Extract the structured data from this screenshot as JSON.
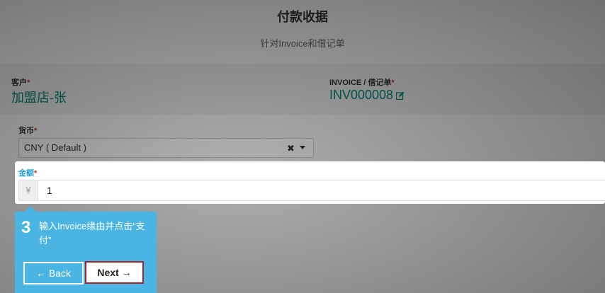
{
  "header": {
    "title": "付款收据",
    "subtitle": "针对Invoice和借记单"
  },
  "customer": {
    "label": "客户",
    "required_mark": "*",
    "value": "加盟店-张"
  },
  "invoice": {
    "label": "INVOICE / 借记单",
    "required_mark": "*",
    "value": "INV000008"
  },
  "currency": {
    "label": "货币",
    "required_mark": "*",
    "selected": "CNY ( Default )",
    "clear_glyph": "✖"
  },
  "amount": {
    "label": "金额",
    "required_mark": "*",
    "currency_symbol": "¥",
    "value": "1"
  },
  "tour": {
    "step": "3",
    "text": "输入Invoice缘由并点击“支付”",
    "back_label": "← Back",
    "next_label": "Next →"
  },
  "colors": {
    "accent_teal": "#00897b",
    "tooltip_blue": "#4ab5e3",
    "required_red": "#c0392b",
    "next_border": "#a4262c"
  }
}
